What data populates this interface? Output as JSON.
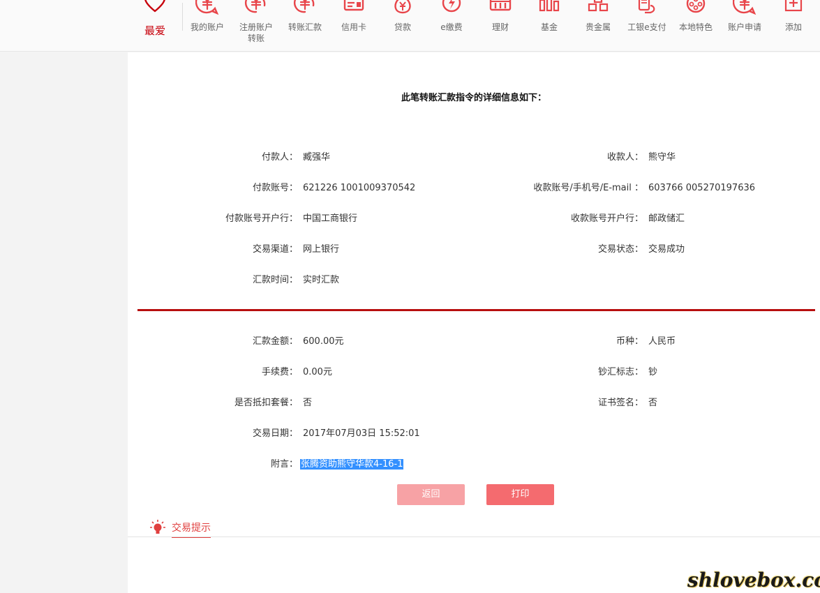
{
  "nav": {
    "favorite_label": "最爱",
    "items": [
      {
        "label": "我的账户",
        "icon": "yuan-chat-icon"
      },
      {
        "label": "注册账户\n转账",
        "icon": "yuan-refresh-icon"
      },
      {
        "label": "转账汇款",
        "icon": "yuan-refresh-icon"
      },
      {
        "label": "信用卡",
        "icon": "credit-card-icon"
      },
      {
        "label": "贷款",
        "icon": "money-bag-icon"
      },
      {
        "label": "e缴费",
        "icon": "lightning-icon"
      },
      {
        "label": "理财",
        "icon": "abacus-icon"
      },
      {
        "label": "基金",
        "icon": "bar-chart-icon"
      },
      {
        "label": "贵金属",
        "icon": "gold-bars-icon"
      },
      {
        "label": "工银e支付",
        "icon": "phone-pay-icon"
      },
      {
        "label": "本地特色",
        "icon": "film-reel-icon"
      },
      {
        "label": "账户申请",
        "icon": "yuan-chat-icon"
      },
      {
        "label": "添加",
        "icon": "plus-square-icon"
      }
    ]
  },
  "detail": {
    "title": "此笔转账汇款指令的详细信息如下：",
    "payer_label": "付款人：",
    "payer": "臧强华",
    "payee_label": "收款人：",
    "payee": "熊守华",
    "payer_account_label": "付款账号：",
    "payer_account": "621226 1001009370542",
    "payee_account_label": "收款账号/手机号/E-mail ：",
    "payee_account": "603766 005270197636",
    "payer_bank_label": "付款账号开户行：",
    "payer_bank": "中国工商银行",
    "payee_bank_label": "收款账号开户行：",
    "payee_bank": "邮政储汇",
    "channel_label": "交易渠道：",
    "channel": "网上银行",
    "status_label": "交易状态：",
    "status": "交易成功",
    "remit_time_label": "汇款时间：",
    "remit_time": "实时汇款",
    "amount_label": "汇款金额：",
    "amount": "600.00元",
    "currency_label": "币种：",
    "currency": "人民币",
    "fee_label": "手续费：",
    "fee": "0.00元",
    "cash_flag_label": "钞汇标志：",
    "cash_flag": "钞",
    "package_label": "是否抵扣套餐：",
    "package": "否",
    "cert_sign_label": "证书签名：",
    "cert_sign": "否",
    "date_label": "交易日期：",
    "date": "2017年07月03日 15:52:01",
    "note_label": "附言：",
    "note": "张腾资助熊守华款4-16-1"
  },
  "buttons": {
    "back": "返回",
    "print": "打印"
  },
  "tips": {
    "label": "交易提示",
    "icon": "lightbulb-icon"
  },
  "watermark": "shlovebox.com",
  "colors": {
    "brand_red": "#c7000b",
    "divider_red": "#b70e0e",
    "button_light": "#f7a2a5",
    "button_primary": "#f46b6f",
    "selection_blue": "#3390ff"
  }
}
